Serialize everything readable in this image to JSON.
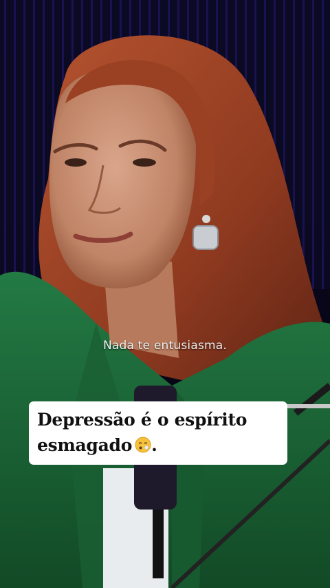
{
  "video": {
    "subtitle": "Nada te entusiasma.",
    "caption_line1": "Depressão é o espírito",
    "caption_line2": "esmagado",
    "caption_end": ".",
    "caption_emoji": "exhausted-face-emoji"
  },
  "colors": {
    "background": "#07061a",
    "curtain_stripe": "#2a1a6e",
    "jacket": "#1f6b3a",
    "hair": "#a8482a",
    "caption_bg": "#ffffff",
    "caption_text": "#111111"
  }
}
